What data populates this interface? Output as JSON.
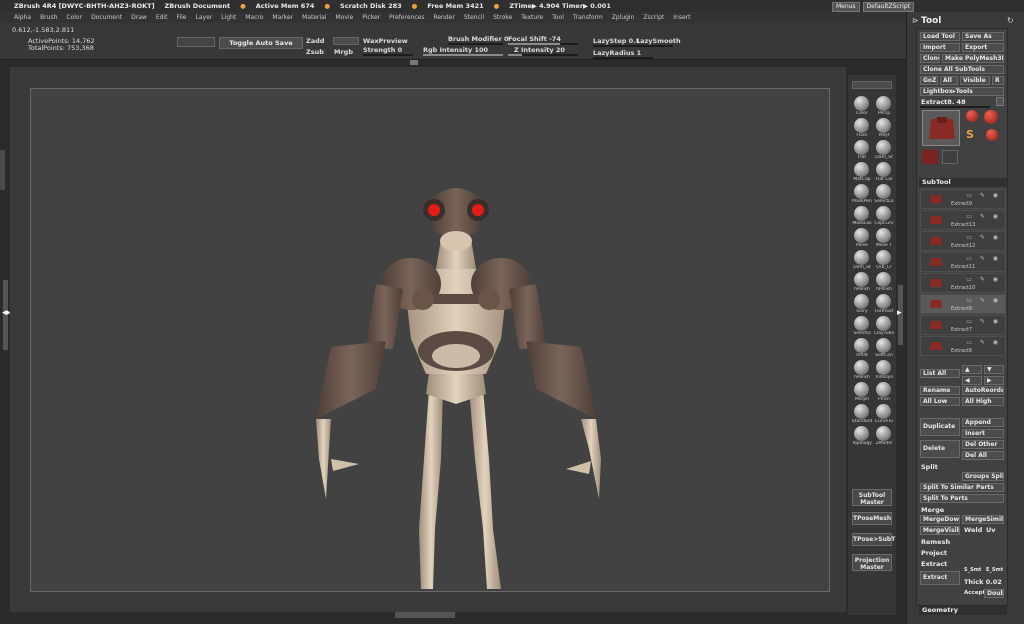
{
  "titlebar": {
    "app": "ZBrush 4R4 [DWYC-BHTH-AHZ3-ROKT]",
    "document": "ZBrush Document",
    "active_mem": "Active Mem 674",
    "scratch_disk": "Scratch Disk 283",
    "free_mem": "Free Mem 3421",
    "ztime": "ZTime▶ 4.904 Timer▶ 0.001"
  },
  "corner": {
    "menus_label": "Menus",
    "script_label": "DefaultZScript"
  },
  "menubar": [
    "Alpha",
    "Brush",
    "Color",
    "Document",
    "Draw",
    "Edit",
    "File",
    "Layer",
    "Light",
    "Macro",
    "Marker",
    "Material",
    "Movie",
    "Picker",
    "Preferences",
    "Render",
    "Stencil",
    "Stroke",
    "Texture",
    "Tool",
    "Transform",
    "Zplugin",
    "Zscript",
    "Insert"
  ],
  "shelf": {
    "coords": "0.612,-1.583,2.811",
    "active_points": "ActivePoints: 14,762",
    "total_points": "TotalPoints: 753,368",
    "toggle_autosave": "Toggle Auto Save",
    "zadd": "Zadd",
    "zsub": "Zsub",
    "mrgb_toggle": "Mrgb",
    "wax_preview": "WaxPreview",
    "strength": "Strength 0",
    "brush_modifier": "Brush Modifier 0",
    "focal_shift": "Focal Shift -74",
    "rgb_intensity": "Rgb Intensity 100",
    "z_intensity": "Z Intensity 20",
    "lazy_step": "LazyStep 0.1",
    "lazy_smooth": "LazySmooth",
    "lazy_radius": "LazyRadius 1",
    "focal_shift_value": -74,
    "rgb_intensity_value": 100,
    "z_intensity_value": 20
  },
  "brushes": [
    {
      "label": "Color",
      "icon": "color-brush-icon"
    },
    {
      "label": "Persp",
      "icon": "persp-icon"
    },
    {
      "label": "Floor",
      "icon": "floor-icon"
    },
    {
      "label": "Polyf",
      "icon": "polyframe-icon"
    },
    {
      "label": "Flat",
      "icon": "flat-material-icon"
    },
    {
      "label": "Dam_St",
      "icon": "dam-standard-icon"
    },
    {
      "label": "MatCap",
      "icon": "matcap-icon"
    },
    {
      "label": "Flat Col",
      "icon": "flat-color-icon"
    },
    {
      "label": "MaskPen",
      "icon": "mask-pen-icon"
    },
    {
      "label": "SelectLa",
      "icon": "select-lasso-icon"
    },
    {
      "label": "MaskLas",
      "icon": "mask-lasso-icon"
    },
    {
      "label": "ClipCurv",
      "icon": "clip-curve-icon"
    },
    {
      "label": "Move",
      "icon": "move-brush-icon"
    },
    {
      "label": "Move T",
      "icon": "move-topo-icon"
    },
    {
      "label": "Dam_St",
      "icon": "dam-standard-icon"
    },
    {
      "label": "Orb_Cr",
      "icon": "orb-cracks-icon"
    },
    {
      "label": "hPolish",
      "icon": "hpolish-icon"
    },
    {
      "label": "hPolish",
      "icon": "hpolish-icon"
    },
    {
      "label": "Ivory",
      "icon": "ivory-icon"
    },
    {
      "label": "FormSof",
      "icon": "form-soft-icon"
    },
    {
      "label": "SelectD",
      "icon": "select-icon"
    },
    {
      "label": "ClayTube",
      "icon": "clay-tubes-icon"
    },
    {
      "label": "Inflat",
      "icon": "inflate-icon"
    },
    {
      "label": "SoftCon",
      "icon": "soft-concrete-icon"
    },
    {
      "label": "hPolish",
      "icon": "hpolish-icon"
    },
    {
      "label": "TrimDyn",
      "icon": "trim-dynamic-icon"
    },
    {
      "label": "Morph",
      "icon": "morph-icon"
    },
    {
      "label": "Pinch",
      "icon": "pinch-icon"
    },
    {
      "label": "Standard",
      "icon": "standard-brush-icon"
    },
    {
      "label": "CurveTu",
      "icon": "curve-tube-icon"
    },
    {
      "label": "Topology",
      "icon": "topology-icon"
    },
    {
      "label": "ZModel",
      "icon": "zmodeler-icon"
    }
  ],
  "rightshelf_buttons": {
    "subtool_master": "SubTool Master",
    "tposemesh": "TPoseMesh",
    "tpose_subt": "TPose>SubT",
    "projection_master": "Projection Master"
  },
  "tray": {
    "title": "Tool",
    "load_tool": "Load Tool",
    "save_as": "Save As",
    "import": "Import",
    "export": "Export",
    "clone": "Clone",
    "make_polymesh": "Make PolyMesh3D",
    "clone_all": "Clone All SubTools",
    "goz": "GoZ",
    "all": "All",
    "visible": "Visible",
    "r": "R",
    "lightbox_tools": "Lightbox▸Tools",
    "current_tool": "Extract8. 48",
    "tool_names": [
      "Sphere3D",
      "PolyMesh3D",
      "SimpleBrush",
      "Cylinder3D",
      "Extract1",
      "Extract8"
    ],
    "subtool_header": "SubTool",
    "subtools": [
      {
        "name": "Extract9"
      },
      {
        "name": "Extract13"
      },
      {
        "name": "Extract12"
      },
      {
        "name": "Extract11"
      },
      {
        "name": "Extract10"
      },
      {
        "name": "Extract8"
      },
      {
        "name": "Extract7"
      },
      {
        "name": "Extract6"
      }
    ],
    "list_all": "List All",
    "rename": "Rename",
    "autoreorder": "AutoReorder",
    "all_low": "All Low",
    "all_high": "All High",
    "duplicate": "Duplicate",
    "append": "Append",
    "insert": "Insert",
    "delete": "Delete",
    "del_other": "Del Other",
    "del_all": "Del All",
    "split_hdr": "Split",
    "groups_split": "Groups Split",
    "split_unmasked": "Split To Similar Parts",
    "split_to_parts": "Split To Parts",
    "merge_hdr": "Merge",
    "merge_down": "MergeDown",
    "merge_similar": "MergeSimilar",
    "merge_visible": "MergeVisible",
    "weld": "Weld",
    "uv": "Uv",
    "remesh": "Remesh",
    "project": "Project",
    "extract_hdr": "Extract",
    "extract": "Extract",
    "s_smt": "S_Smt",
    "e_smt": "E_Smt",
    "thick": "Thick 0.02",
    "accept": "Accept",
    "double": "Double",
    "geometry": "Geometry"
  },
  "colors": {
    "accent_red": "#c0392b",
    "goggle_red": "#e41b1b",
    "skin": "#d8c8b2",
    "armor": "#6e5a50"
  }
}
